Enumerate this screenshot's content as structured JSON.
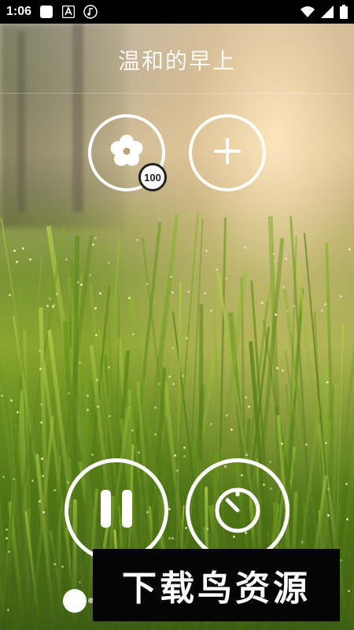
{
  "status_bar": {
    "time": "1:06",
    "icons": [
      "square-notification-icon",
      "a-keyboard-icon",
      "music-note-icon",
      "wifi-icon",
      "signal-icon",
      "battery-icon"
    ]
  },
  "scene": {
    "title": "温和的早上"
  },
  "sound_mixer": {
    "flower_sound_volume": "100",
    "flower_icon": "flower-icon",
    "add_icon": "plus-icon"
  },
  "controls": {
    "play_state_icon": "pause-icon",
    "timer_icon": "timer-icon"
  },
  "watermark": {
    "text": "下载鸟资源"
  },
  "colors": {
    "status_bar": "#000000",
    "ring": "#ffffff",
    "watermark_bg": "#050505"
  }
}
